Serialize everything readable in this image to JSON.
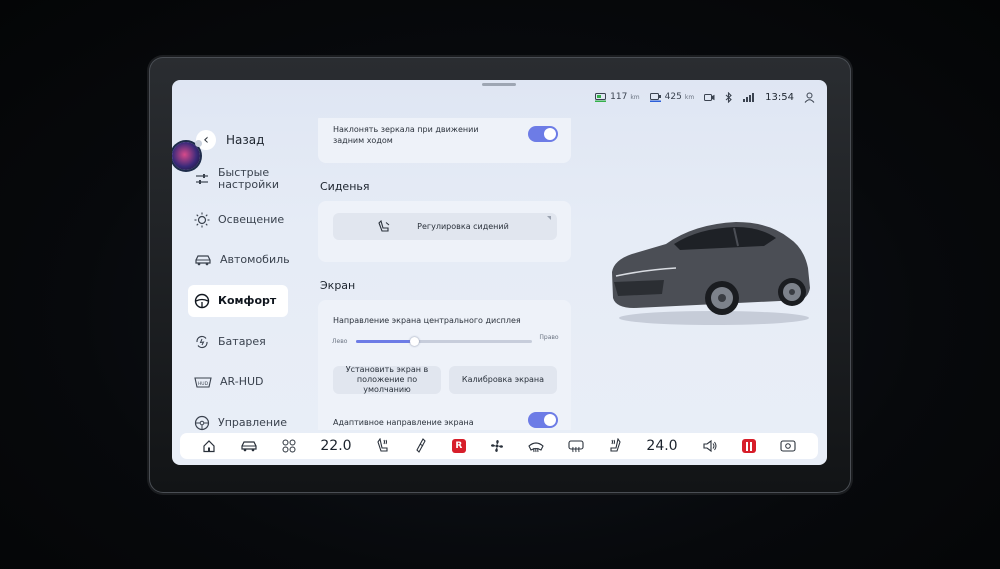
{
  "status": {
    "range1": "117",
    "range1_unit": "km",
    "range2": "425",
    "range2_unit": "km",
    "time": "13:54"
  },
  "sidebar": {
    "back_label": "Назад",
    "items": [
      {
        "label": "Быстрые настройки",
        "icon": "sliders-icon"
      },
      {
        "label": "Освещение",
        "icon": "sun-icon"
      },
      {
        "label": "Автомобиль",
        "icon": "car-icon"
      },
      {
        "label": "Комфорт",
        "icon": "steering-wheel-icon",
        "active": true
      },
      {
        "label": "Батарея",
        "icon": "battery-cycle-icon"
      },
      {
        "label": "AR-HUD",
        "icon": "hud-icon"
      },
      {
        "label": "Управление",
        "icon": "steering-icon"
      }
    ]
  },
  "content": {
    "mirror_setting": "Наклонять зеркала при движении задним ходом",
    "seats_title": "Сиденья",
    "seats_button": "Регулировка сидений",
    "screen_title": "Экран",
    "screen_direction_label": "Направление экрана центрального дисплея",
    "slider_left": "Лево",
    "slider_right": "Право",
    "slider_value": 0.33,
    "default_position_button": "Установить экран в положение по умолчанию",
    "calibration_button": "Калибровка экрана",
    "adaptive_label": "Адаптивное направление экрана"
  },
  "dock": {
    "temp_left": "22.0",
    "temp_right": "24.0"
  },
  "colors": {
    "accent": "#6d7ce6",
    "screen_bg": "#e6ecf6",
    "red_badge": "#d71e2a"
  }
}
